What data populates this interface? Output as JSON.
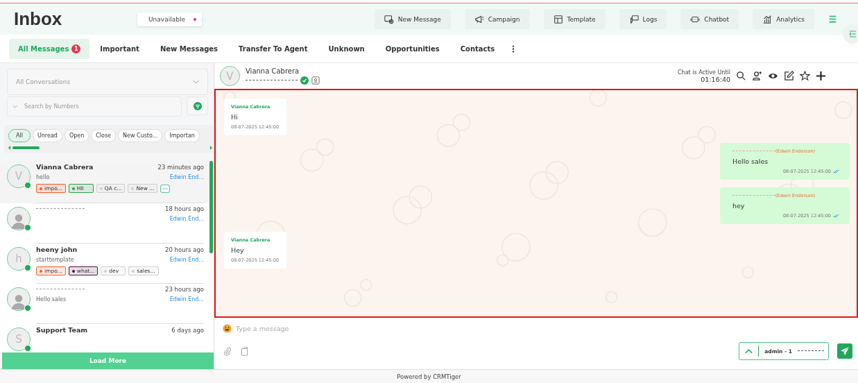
{
  "header": {
    "title": "Inbox",
    "status": {
      "label": "Unavailable",
      "color": "#ee3355"
    },
    "actions": [
      {
        "label": "New Message"
      },
      {
        "label": "Campaign"
      },
      {
        "label": "Template"
      },
      {
        "label": "Logs"
      },
      {
        "label": "Chatbot"
      },
      {
        "label": "Analytics"
      }
    ]
  },
  "tabs": [
    {
      "label": "All Messages",
      "selected": true,
      "badge": "1"
    },
    {
      "label": "Important",
      "selected": false
    },
    {
      "label": "New Messages",
      "selected": false
    },
    {
      "label": "Transfer To Agent",
      "selected": false
    },
    {
      "label": "Unknown",
      "selected": false
    },
    {
      "label": "Opportunities",
      "selected": false
    },
    {
      "label": "Contacts",
      "selected": false
    }
  ],
  "sidebar": {
    "dropdown": {
      "placeholder": "All Conversations"
    },
    "search": {
      "placeholder": "Search by Numbers"
    },
    "filters": [
      {
        "label": "All",
        "selected": true
      },
      {
        "label": "Unread",
        "selected": false
      },
      {
        "label": "Open",
        "selected": false
      },
      {
        "label": "Close",
        "selected": false
      },
      {
        "label": "New Custo...",
        "selected": false
      },
      {
        "label": "Importan",
        "selected": false
      }
    ],
    "conversations": [
      {
        "kind": "letter",
        "letter": "V",
        "name": "Vianna Cabrera",
        "time": "23 minutes ago",
        "preview": "hello",
        "agent": "Edwin End...",
        "tags": [
          {
            "label": "impo...",
            "color": "#ff5722"
          },
          {
            "label": "HII",
            "color": "#2e9e4f"
          },
          {
            "label": "QA c...",
            "color": "#d0d0d0"
          },
          {
            "label": "New ...",
            "color": "#d0d0d0"
          }
        ],
        "more": true
      },
      {
        "kind": "person",
        "time": "18 hours ago",
        "agent": "Edwin End..."
      },
      {
        "kind": "letter",
        "letter": "h",
        "name": "heeny john",
        "time": "20 hours ago",
        "preview": "starttemplate",
        "agent": "Edwin End...",
        "tags": [
          {
            "label": "impo...",
            "color": "#ff5722"
          },
          {
            "label": "what...",
            "color": "#4a1040"
          },
          {
            "label": "dev",
            "color": "#d0d0d0"
          },
          {
            "label": "sales...",
            "color": "#d0d0d0"
          }
        ]
      },
      {
        "kind": "person",
        "time": "23 hours ago",
        "preview": "Hello sales",
        "agent": "Edwin End..."
      },
      {
        "kind": "letter",
        "letter": "S",
        "name": "Support Team",
        "time": "6 days ago"
      }
    ],
    "load_more": "Load More"
  },
  "chat": {
    "contact": {
      "letter": "V",
      "name": "Vianna Cabrera"
    },
    "active_label": "Chat is Active Until",
    "timer": "01:16:40",
    "messages": [
      {
        "kind": "incoming",
        "sender": "Vianna Cabrera",
        "text": "Hi",
        "time": "08-07-2025 12:45:00"
      },
      {
        "kind": "outgoing",
        "sender": "(Edwin Enderson)",
        "text": "Hello sales",
        "time": "08-07-2025 12:45:00",
        "read": true
      },
      {
        "kind": "outgoing",
        "sender": "(Edwin Enderson)",
        "text": "hey",
        "time": "08-07-2025 12:45:00",
        "read": true
      },
      {
        "kind": "incoming",
        "sender": "Vianna Cabrera",
        "text": "Hey",
        "time": "08-07-2025 12:45:00"
      }
    ],
    "composer": {
      "placeholder": "Type a message",
      "agent": "admin - 1"
    }
  },
  "footer": "Powered by CRMTiger"
}
